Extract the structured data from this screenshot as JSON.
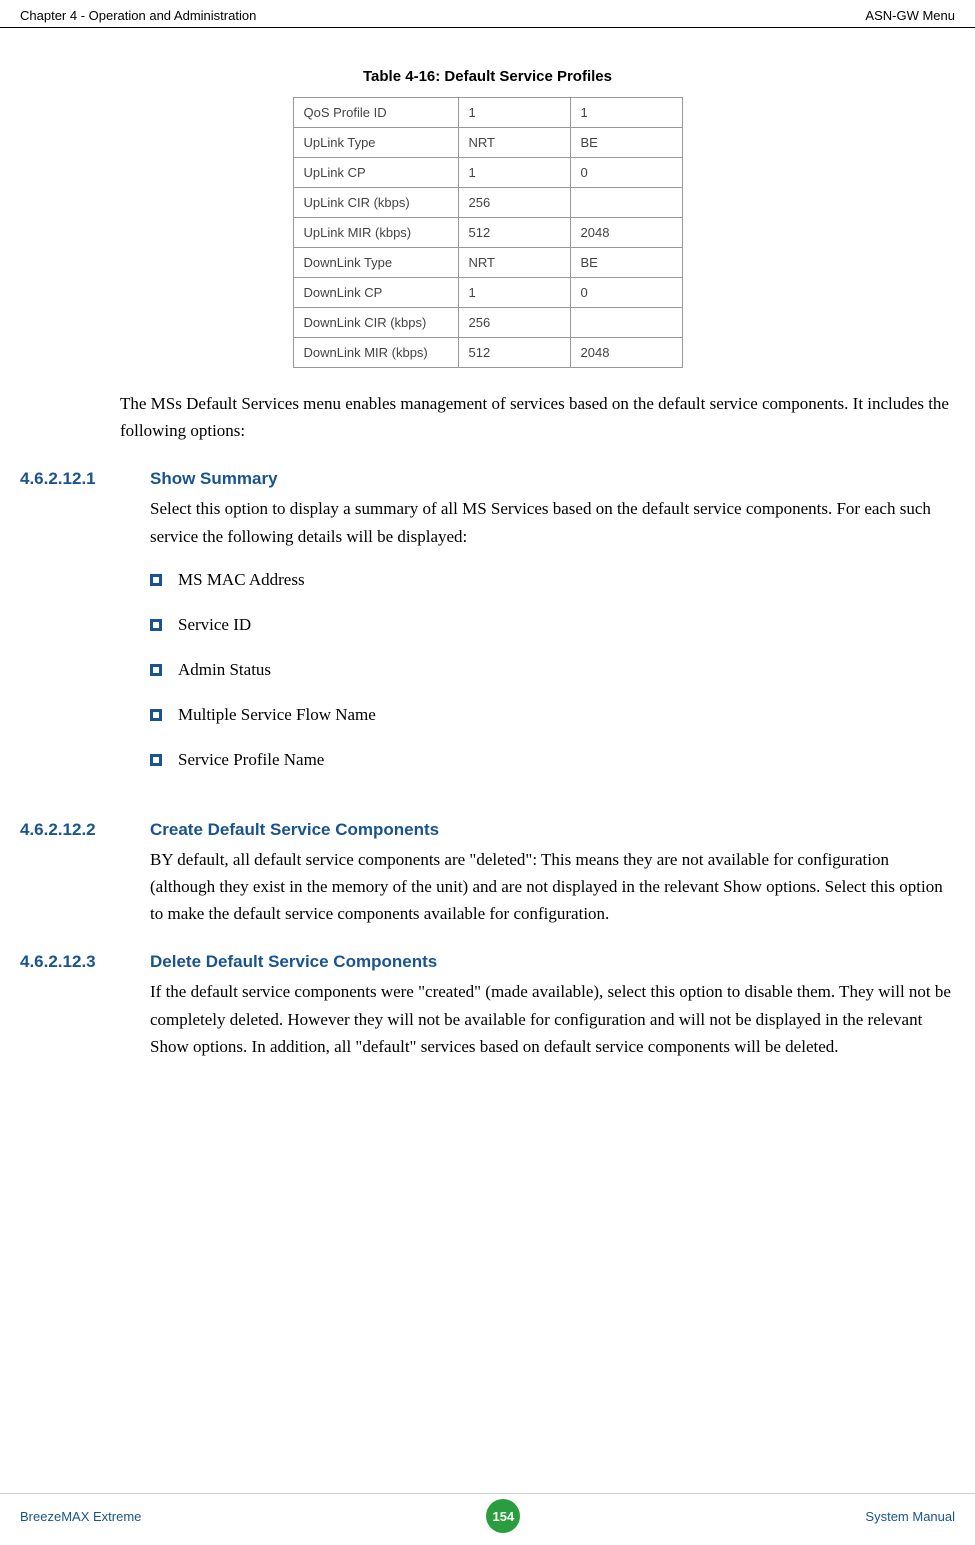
{
  "header": {
    "left": "Chapter 4 - Operation and Administration",
    "right": "ASN-GW Menu"
  },
  "table": {
    "caption": "Table 4-16: Default Service Profiles",
    "rows": [
      {
        "label": "QoS Profile ID",
        "col1": "1",
        "col2": "1"
      },
      {
        "label": "UpLink Type",
        "col1": "NRT",
        "col2": "BE"
      },
      {
        "label": "UpLink CP",
        "col1": "1",
        "col2": "0"
      },
      {
        "label": "UpLink CIR (kbps)",
        "col1": "256",
        "col2": ""
      },
      {
        "label": "UpLink MIR (kbps)",
        "col1": "512",
        "col2": "2048"
      },
      {
        "label": "DownLink Type",
        "col1": "NRT",
        "col2": "BE"
      },
      {
        "label": "DownLink CP",
        "col1": "1",
        "col2": "0"
      },
      {
        "label": "DownLink CIR (kbps)",
        "col1": "256",
        "col2": ""
      },
      {
        "label": "DownLink MIR (kbps)",
        "col1": "512",
        "col2": "2048"
      }
    ]
  },
  "intro_text": "The MSs Default Services menu enables management of services based on the default service components. It includes the following options:",
  "sections": [
    {
      "num": "4.6.2.12.1",
      "title": "Show Summary",
      "text": "Select this option to display a summary of all MS Services based on the default service components. For each such service the following details will be displayed:",
      "bullets": [
        "MS MAC Address",
        "Service ID",
        "Admin Status",
        "Multiple Service Flow Name",
        "Service Profile Name"
      ]
    },
    {
      "num": "4.6.2.12.2",
      "title": "Create Default Service Components",
      "text": "BY default, all default service components are \"deleted\": This means they are not available for configuration (although they exist in the memory of the unit) and are not displayed in the relevant Show options. Select this option to make the default service components available for configuration."
    },
    {
      "num": "4.6.2.12.3",
      "title": "Delete Default Service Components",
      "text": "If the default service components were \"created\" (made available), select this option to disable them. They will not be completely deleted. However they will not be available for configuration and will not be displayed in the relevant Show options. In addition, all \"default\" services based on default service components will be deleted."
    }
  ],
  "footer": {
    "left": "BreezeMAX Extreme",
    "page": "154",
    "right": "System Manual"
  }
}
